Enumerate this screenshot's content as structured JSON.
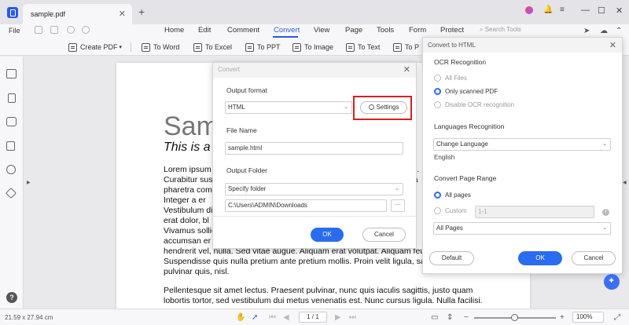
{
  "titlebar": {
    "tab_label": "sample.pdf",
    "tab_close": "✕",
    "tab_add": "+",
    "win_minimize": "—",
    "win_maximize": "☐",
    "win_close": "✕"
  },
  "menubar": {
    "file": "File",
    "items": [
      "Home",
      "Edit",
      "Comment",
      "Convert",
      "View",
      "Page",
      "Tools",
      "Form",
      "Protect"
    ],
    "active": "Convert",
    "search_placeholder": "Search Tools"
  },
  "toolbar": {
    "create_pdf": "Create PDF",
    "create_pdf_caret": "▾",
    "tools": [
      "To Word",
      "To Excel",
      "To PPT",
      "To Image",
      "To Text",
      "To P"
    ]
  },
  "document": {
    "title": "Samp",
    "subtitle": "This is a s",
    "lines_left": [
      "Lorem ipsum",
      "Curabitur sus",
      "pharetra com",
      "Integer a er",
      "Vestibulum di",
      "erat dolor, bl",
      "Vivamus sollic",
      "accumsan er"
    ],
    "lines_right_hint": [
      "uis.",
      "ma",
      "fa",
      "nti",
      "sa",
      "ec",
      "si"
    ],
    "lines_full": [
      "hendrerit vel, nulla. Sed vitae augue. Aliquam erat volutpat. Aliquam feugiat vulputate nisl.",
      "Suspendisse quis nulla pretium ante pretium mollis. Proin velit ligula, sagittis at, egestas a,",
      "pulvinar quis, nisl.",
      "",
      "Pellentesque sit amet lectus. Praesent pulvinar, nunc quis iaculis sagittis, justo quam",
      "lobortis tortor, sed vestibulum dui metus venenatis est. Nunc cursus ligula. Nulla facilisi."
    ]
  },
  "convert_dialog": {
    "title": "Convert",
    "close": "✕",
    "output_format_label": "Output format",
    "output_format_value": "HTML",
    "settings_label": "Settings",
    "file_name_label": "File Name",
    "file_name_value": "sample.html",
    "output_folder_label": "Output Folder",
    "folder_select_value": "Specify folder",
    "folder_path": "C:\\Users\\ADMIN\\Downloads",
    "browse_label": "···",
    "ok_label": "OK",
    "cancel_label": "Cancel"
  },
  "html_panel": {
    "title": "Convert to HTML",
    "close": "✕",
    "ocr_label": "OCR Recognition",
    "ocr_options": [
      "All Files",
      "Only scanned PDF",
      "Disable OCR recognition"
    ],
    "ocr_selected": 1,
    "lang_label": "Languages Recognition",
    "lang_select": "Change Language",
    "lang_value": "English",
    "range_label": "Convert Page Range",
    "range_all": "All pages",
    "range_custom": "Custom",
    "range_custom_value": "1-1",
    "range_select": "All Pages",
    "info": "i",
    "default_label": "Default",
    "ok_label": "OK",
    "cancel_label": "Cancel"
  },
  "statusbar": {
    "dimensions": "21.59 x 27.94 cm",
    "page_indicator": "1 / 1",
    "zoom": "100%"
  },
  "colors": {
    "accent": "#2a58e6",
    "button_blue": "#2a6cf0",
    "highlight_red": "#d02222"
  }
}
